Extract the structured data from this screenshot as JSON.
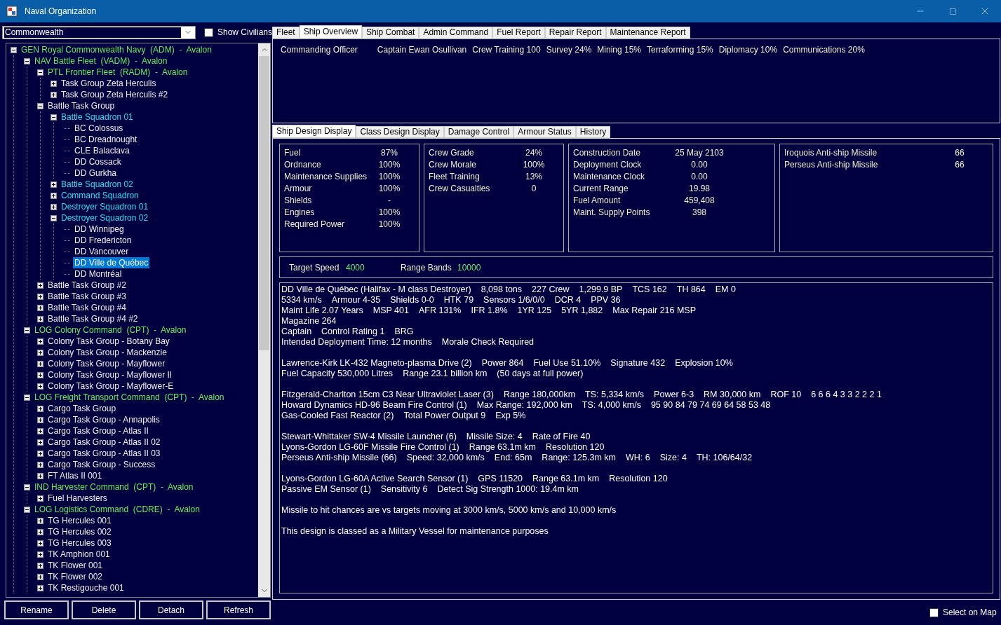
{
  "window": {
    "title": "Naval Organization"
  },
  "race_select": {
    "value": "Commonwealth"
  },
  "show_civilians": {
    "label": "Show Civilians",
    "checked": false
  },
  "tree": [
    {
      "label": "GEN Royal Commonwealth Navy  (ADM)  -  Avalon",
      "kind": "command",
      "expanded": true,
      "selected": false,
      "children": [
        {
          "label": "NAV Battle Fleet  (VADM)  -  Avalon",
          "kind": "command",
          "expanded": true,
          "selected": false,
          "children": [
            {
              "label": "PTL Frontier Fleet  (RADM)  -  Avalon",
              "kind": "command",
              "expanded": true,
              "selected": false,
              "children": [
                {
                  "label": "Task Group Zeta Herculis",
                  "kind": "group",
                  "expanded": false,
                  "selected": false
                },
                {
                  "label": "Task Group Zeta Herculis #2",
                  "kind": "group",
                  "expanded": false,
                  "selected": false
                }
              ]
            },
            {
              "label": "Battle Task Group",
              "kind": "group",
              "expanded": true,
              "selected": false,
              "children": [
                {
                  "label": "Battle Squadron 01",
                  "kind": "squadron",
                  "expanded": true,
                  "selected": false,
                  "children": [
                    {
                      "label": "BC Colossus",
                      "kind": "ship",
                      "selected": false
                    },
                    {
                      "label": "BC Dreadnought",
                      "kind": "ship",
                      "selected": false
                    },
                    {
                      "label": "CLE Balaclava",
                      "kind": "ship",
                      "selected": false
                    },
                    {
                      "label": "DD Cossack",
                      "kind": "ship",
                      "selected": false
                    },
                    {
                      "label": "DD Gurkha",
                      "kind": "ship",
                      "selected": false
                    }
                  ]
                },
                {
                  "label": "Battle Squadron 02",
                  "kind": "squadron",
                  "expanded": false,
                  "selected": false
                },
                {
                  "label": "Command Squadron",
                  "kind": "squadron",
                  "expanded": false,
                  "selected": false
                },
                {
                  "label": "Destroyer Squadron 01",
                  "kind": "squadron",
                  "expanded": false,
                  "selected": false
                },
                {
                  "label": "Destroyer Squadron 02",
                  "kind": "squadron",
                  "expanded": true,
                  "selected": false,
                  "children": [
                    {
                      "label": "DD Winnipeg",
                      "kind": "ship",
                      "selected": false
                    },
                    {
                      "label": "DD Fredericton",
                      "kind": "ship",
                      "selected": false
                    },
                    {
                      "label": "DD Vancouver",
                      "kind": "ship",
                      "selected": false
                    },
                    {
                      "label": "DD Ville de Québec",
                      "kind": "ship",
                      "selected": true
                    },
                    {
                      "label": "DD Montréal",
                      "kind": "ship",
                      "selected": false
                    }
                  ]
                }
              ]
            },
            {
              "label": "Battle Task Group #2",
              "kind": "group",
              "expanded": false,
              "selected": false
            },
            {
              "label": "Battle Task Group #3",
              "kind": "group",
              "expanded": false,
              "selected": false
            },
            {
              "label": "Battle Task Group #4",
              "kind": "group",
              "expanded": false,
              "selected": false
            },
            {
              "label": "Battle Task Group #4 #2",
              "kind": "group",
              "expanded": false,
              "selected": false
            }
          ]
        },
        {
          "label": "LOG Colony Command  (CPT)  -  Avalon",
          "kind": "command",
          "expanded": true,
          "selected": false,
          "children": [
            {
              "label": "Colony Task Group - Botany Bay",
              "kind": "group",
              "expanded": false,
              "selected": false
            },
            {
              "label": "Colony Task Group - Mackenzie",
              "kind": "group",
              "expanded": false,
              "selected": false
            },
            {
              "label": "Colony Task Group - Mayflower",
              "kind": "group",
              "expanded": false,
              "selected": false
            },
            {
              "label": "Colony Task Group - Mayflower II",
              "kind": "group",
              "expanded": false,
              "selected": false
            },
            {
              "label": "Colony Task Group - Mayflower-E",
              "kind": "group",
              "expanded": false,
              "selected": false
            }
          ]
        },
        {
          "label": "LOG Freight Transport Command  (CPT)  -  Avalon",
          "kind": "command",
          "expanded": true,
          "selected": false,
          "children": [
            {
              "label": "Cargo Task Group",
              "kind": "group",
              "expanded": false,
              "selected": false
            },
            {
              "label": "Cargo Task Group - Annapolis",
              "kind": "group",
              "expanded": false,
              "selected": false
            },
            {
              "label": "Cargo Task Group - Atlas II",
              "kind": "group",
              "expanded": false,
              "selected": false
            },
            {
              "label": "Cargo Task Group - Atlas II 02",
              "kind": "group",
              "expanded": false,
              "selected": false
            },
            {
              "label": "Cargo Task Group - Atlas II 03",
              "kind": "group",
              "expanded": false,
              "selected": false
            },
            {
              "label": "Cargo Task Group - Success",
              "kind": "group",
              "expanded": false,
              "selected": false
            },
            {
              "label": "FT Atlas II 001",
              "kind": "group",
              "expanded": false,
              "selected": false
            }
          ]
        },
        {
          "label": "IND Harvester Command  (CPT)  -  Avalon",
          "kind": "command",
          "expanded": true,
          "selected": false,
          "children": [
            {
              "label": "Fuel Harvesters",
              "kind": "group",
              "expanded": false,
              "selected": false
            }
          ]
        },
        {
          "label": "LOG Logistics Command  (CDRE)  -  Avalon",
          "kind": "command",
          "expanded": true,
          "selected": false,
          "children": [
            {
              "label": "TG Hercules 001",
              "kind": "group",
              "expanded": false,
              "selected": false
            },
            {
              "label": "TG Hercules 002",
              "kind": "group",
              "expanded": false,
              "selected": false
            },
            {
              "label": "TG Hercules 003",
              "kind": "group",
              "expanded": false,
              "selected": false
            },
            {
              "label": "TK Amphion 001",
              "kind": "group",
              "expanded": false,
              "selected": false
            },
            {
              "label": "TK Flower 001",
              "kind": "group",
              "expanded": false,
              "selected": false
            },
            {
              "label": "TK Flower 002",
              "kind": "group",
              "expanded": false,
              "selected": false
            },
            {
              "label": "TK Restigouche 001",
              "kind": "group",
              "expanded": false,
              "selected": false
            }
          ]
        }
      ]
    }
  ],
  "buttons": [
    "Rename",
    "Delete",
    "Detach",
    "Refresh"
  ],
  "tabs": [
    {
      "label": "Fleet",
      "selected": false
    },
    {
      "label": "Ship Overview",
      "selected": true
    },
    {
      "label": "Ship Combat",
      "selected": false
    },
    {
      "label": "Admin Command",
      "selected": false
    },
    {
      "label": "Fuel Report",
      "selected": false
    },
    {
      "label": "Repair Report",
      "selected": false
    },
    {
      "label": "Maintenance Report",
      "selected": false
    }
  ],
  "officer": {
    "label": "Commanding Officer",
    "items": [
      "Captain Ewan Osullivan",
      "Crew Training 100",
      "Survey 24%",
      "Mining 15%",
      "Terraforming 15%",
      "Diplomacy 10%",
      "Communications 20%"
    ]
  },
  "sub_tabs": [
    {
      "label": "Ship Design Display",
      "selected": true
    },
    {
      "label": "Class Design Display",
      "selected": false
    },
    {
      "label": "Damage Control",
      "selected": false
    },
    {
      "label": "Armour Status",
      "selected": false
    },
    {
      "label": "History",
      "selected": false
    }
  ],
  "stat_panels": [
    [
      {
        "label": "Fuel",
        "value": "87%"
      },
      {
        "label": "Ordnance",
        "value": "100%"
      },
      {
        "label": "Maintenance Supplies",
        "value": "100%"
      },
      {
        "label": "Armour",
        "value": "100%"
      },
      {
        "label": "Shields",
        "value": "-"
      },
      {
        "label": "Engines",
        "value": "100%"
      },
      {
        "label": "Required Power",
        "value": "100%"
      }
    ],
    [
      {
        "label": "Crew Grade",
        "value": "24%"
      },
      {
        "label": "Crew Morale",
        "value": "100%"
      },
      {
        "label": "Fleet Training",
        "value": "13%"
      },
      {
        "label": "Crew Casualties",
        "value": "0"
      }
    ],
    [
      {
        "label": "Construction Date",
        "value": "25 May 2103"
      },
      {
        "label": "Deployment Clock",
        "value": "0.00"
      },
      {
        "label": "Maintenance Clock",
        "value": "0.00"
      },
      {
        "label": "Current Range",
        "value": "19.98"
      },
      {
        "label": "Fuel Amount",
        "value": "459,408"
      },
      {
        "label": "Maint. Supply Points",
        "value": "398"
      }
    ],
    [
      {
        "label": "Iroquois Anti-ship Missile",
        "value": "66"
      },
      {
        "label": "Perseus Anti-ship Missile",
        "value": "66"
      }
    ]
  ],
  "speed_bar": [
    {
      "label": "Target Speed",
      "value": "4000"
    },
    {
      "label": "Range Bands",
      "value": "10000"
    }
  ],
  "design_text": [
    [
      [
        "DD Ville de Québec  (Halifax - M class Destroyer)",
        "8,098 tons",
        "227 Crew",
        "1,299.9 BP",
        "TCS 162",
        "TH 864",
        "EM 0"
      ],
      [
        "5334 km/s",
        "Armour 4-35",
        "Shields 0-0",
        "HTK 79",
        "Sensors 1/6/0/0",
        "DCR 4",
        "PPV 36"
      ],
      [
        "Maint Life 2.07 Years",
        "MSP 401",
        "AFR 131%",
        "IFR 1.8%",
        "1YR 125",
        "5YR 1,882",
        "Max Repair 216 MSP"
      ],
      [
        "Magazine 264"
      ],
      [
        "Captain",
        "Control Rating 1",
        "BRG"
      ],
      [
        "Intended Deployment Time: 12 months",
        "Morale Check Required"
      ]
    ],
    [
      [
        "Lawrence-Kirk LK-432 Magneto-plasma Drive (2)",
        "Power 864",
        "Fuel Use 51.10%",
        "Signature 432",
        "Explosion 10%"
      ],
      [
        "Fuel Capacity 530,000 Litres",
        "Range 23.1 billion km",
        "(50 days at full power)"
      ]
    ],
    [
      [
        "Fitzgerald-Charlton 15cm C3 Near Ultraviolet Laser (3)",
        "Range 180,000km",
        "TS: 5,334 km/s",
        "Power 6-3",
        "RM 30,000 km",
        "ROF 10",
        "6 6 6 4 3 3 2 2 2 1"
      ],
      [
        "Howard Dynamics HD-96 Beam Fire Control (1)",
        "Max Range: 192,000 km",
        "TS: 4,000 km/s",
        "95 90 84 79 74 69 64 58 53 48"
      ],
      [
        "Gas-Cooled Fast Reactor (2)",
        "Total Power Output 9",
        "Exp 5%"
      ]
    ],
    [
      [
        "Stewart-Whittaker SW-4 Missile Launcher (6)",
        "Missile Size: 4",
        "Rate of Fire 40"
      ],
      [
        "Lyons-Gordon LG-60F Missile Fire Control (1)",
        "Range 63.1m km",
        "Resolution 120"
      ],
      [
        "Perseus Anti-ship Missile (66)",
        "Speed: 32,000 km/s",
        "End: 65m",
        "Range: 125.3m km",
        "WH: 6",
        "Size: 4",
        "TH: 106/64/32"
      ]
    ],
    [
      [
        "Lyons-Gordon LG-60A Active Search Sensor (1)",
        "GPS 11520",
        "Range 63.1m km",
        "Resolution 120"
      ],
      [
        "Passive EM Sensor (1)",
        "Sensitivity 6",
        "Detect Sig Strength 1000:  19.4m km"
      ]
    ],
    [
      [
        "Missile to hit chances are vs targets moving at 3000 km/s, 5000 km/s and 10,000 km/s"
      ]
    ],
    [
      [
        "This design is classed as a Military Vessel for maintenance purposes"
      ]
    ]
  ],
  "select_on_map": {
    "label": "Select on Map",
    "checked": false
  }
}
